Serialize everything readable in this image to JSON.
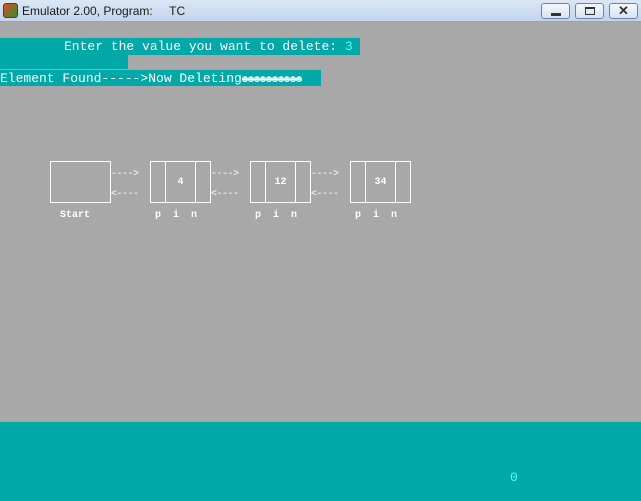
{
  "window": {
    "title": "Emulator 2.00, Program:     TC",
    "min_label": "—",
    "max_label": "□",
    "close_label": "✕"
  },
  "console": {
    "prompt_text": "Enter the value you want to delete: ",
    "prompt_value": "3",
    "status_text": "Element Found----->Now Deleting",
    "status_trail": "☻☻☻☻☻☻☻☻☻☻",
    "colors": {
      "background": "#a8a8a8",
      "highlight": "#00a8a8",
      "text": "#ffffff",
      "accent": "#55ffff"
    }
  },
  "diagram": {
    "start_label": "Start",
    "arrow_forward": "---->",
    "arrow_back": "<----",
    "nodes": [
      {
        "value": "4",
        "labels": "p  i  n"
      },
      {
        "value": "12",
        "labels": "p  i  n"
      },
      {
        "value": "34",
        "labels": "p  i  n"
      }
    ]
  },
  "bottom_bar": {
    "counter": "0"
  }
}
